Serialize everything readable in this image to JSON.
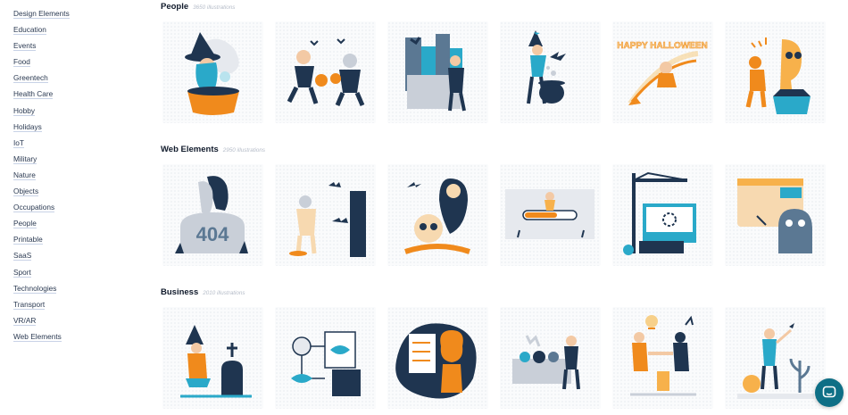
{
  "sidebar": {
    "items": [
      {
        "label": "Design Elements"
      },
      {
        "label": "Education"
      },
      {
        "label": "Events"
      },
      {
        "label": "Food"
      },
      {
        "label": "Greentech"
      },
      {
        "label": "Health Care"
      },
      {
        "label": "Hobby"
      },
      {
        "label": "Holidays"
      },
      {
        "label": "IoT"
      },
      {
        "label": "Military"
      },
      {
        "label": "Nature"
      },
      {
        "label": "Objects"
      },
      {
        "label": "Occupations"
      },
      {
        "label": "People"
      },
      {
        "label": "Printable"
      },
      {
        "label": "SaaS"
      },
      {
        "label": "Sport"
      },
      {
        "label": "Technologies"
      },
      {
        "label": "Transport"
      },
      {
        "label": "VR/AR"
      },
      {
        "label": "Web Elements"
      }
    ]
  },
  "sections": [
    {
      "title": "People",
      "count": "3650 illustrations",
      "tiles": [
        {
          "icon": "witch-cauldron-illustration"
        },
        {
          "icon": "trick-or-treat-kids-illustration"
        },
        {
          "icon": "zombie-city-illustration"
        },
        {
          "icon": "little-witch-illustration"
        },
        {
          "icon": "happy-halloween-broom-illustration",
          "text": "HAPPY HALLOWEEN"
        },
        {
          "icon": "skull-ghost-box-illustration"
        }
      ]
    },
    {
      "title": "Web Elements",
      "count": "2950 illustrations",
      "tiles": [
        {
          "icon": "404-tombstone-illustration",
          "text": "404"
        },
        {
          "icon": "mummy-bats-illustration"
        },
        {
          "icon": "grim-reaper-skull-illustration"
        },
        {
          "icon": "loading-bar-illustration"
        },
        {
          "icon": "crane-browser-illustration"
        },
        {
          "icon": "monster-browser-illustration"
        }
      ]
    },
    {
      "title": "Business",
      "count": "2010 illustrations",
      "tiles": [
        {
          "icon": "witch-grave-illustration"
        },
        {
          "icon": "eye-diagram-illustration"
        },
        {
          "icon": "pumpkin-checklist-illustration"
        },
        {
          "icon": "pumpkin-crate-illustration"
        },
        {
          "icon": "handshake-deal-illustration"
        },
        {
          "icon": "growth-plant-illustration"
        }
      ]
    }
  ],
  "chat": {
    "icon": "chat-bubble-icon"
  },
  "colors": {
    "navy": "#1f3550",
    "orange": "#f08a1c",
    "teal": "#2aa9c9",
    "tile_bg": "#fafbfc"
  }
}
